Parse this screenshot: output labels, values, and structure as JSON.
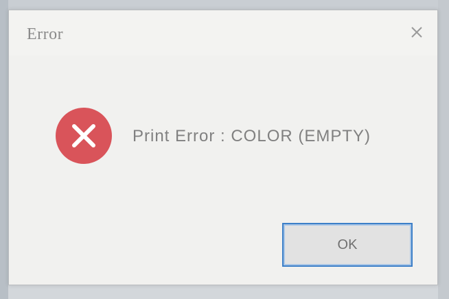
{
  "dialog": {
    "title": "Error",
    "message": "Print Error : COLOR (EMPTY)",
    "ok_label": "OK",
    "close_icon": "close-icon",
    "status_icon": "error-icon"
  },
  "colors": {
    "error_red": "#d9545a",
    "accent_blue": "#3c7fc8",
    "dialog_bg": "#f1f1ef",
    "text_gray": "#808080"
  }
}
